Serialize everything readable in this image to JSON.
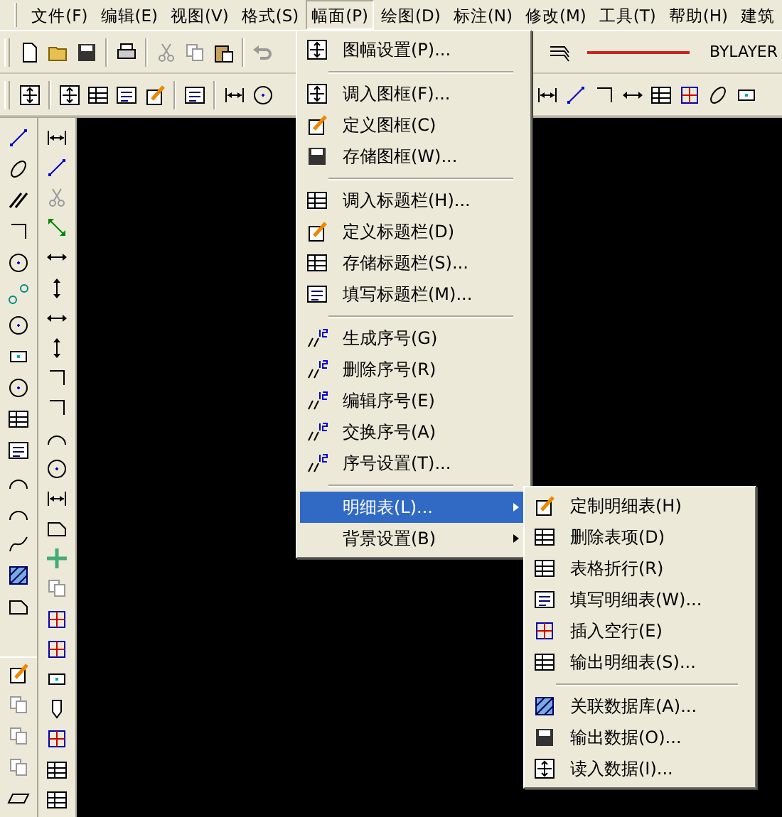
{
  "menubar": [
    {
      "label": "文件(F)",
      "selected": false
    },
    {
      "label": "编辑(E)",
      "selected": false
    },
    {
      "label": "视图(V)",
      "selected": false
    },
    {
      "label": "格式(S)",
      "selected": false
    },
    {
      "label": "幅面(P)",
      "selected": true
    },
    {
      "label": "绘图(D)",
      "selected": false
    },
    {
      "label": "标注(N)",
      "selected": false
    },
    {
      "label": "修改(M)",
      "selected": false
    },
    {
      "label": "工具(T)",
      "selected": false
    },
    {
      "label": "帮助(H)",
      "selected": false
    },
    {
      "label": "建筑",
      "selected": false
    }
  ],
  "toolbar": {
    "line_type": "BYLAYER"
  },
  "menu": {
    "items": [
      {
        "kind": "item",
        "label": "图幅设置(P)...",
        "selected": false
      },
      {
        "kind": "separator"
      },
      {
        "kind": "item",
        "label": "调入图框(F)...",
        "selected": false
      },
      {
        "kind": "item",
        "label": "定义图框(C)",
        "selected": false
      },
      {
        "kind": "item",
        "label": "存储图框(W)...",
        "selected": false
      },
      {
        "kind": "separator"
      },
      {
        "kind": "item",
        "label": "调入标题栏(H)...",
        "selected": false
      },
      {
        "kind": "item",
        "label": "定义标题栏(D)",
        "selected": false
      },
      {
        "kind": "item",
        "label": "存储标题栏(S)...",
        "selected": false
      },
      {
        "kind": "item",
        "label": "填写标题栏(M)...",
        "selected": false
      },
      {
        "kind": "separator"
      },
      {
        "kind": "item",
        "label": "生成序号(G)",
        "selected": false
      },
      {
        "kind": "item",
        "label": "删除序号(R)",
        "selected": false
      },
      {
        "kind": "item",
        "label": "编辑序号(E)",
        "selected": false
      },
      {
        "kind": "item",
        "label": "交换序号(A)",
        "selected": false
      },
      {
        "kind": "item",
        "label": "序号设置(T)...",
        "selected": false
      },
      {
        "kind": "separator"
      },
      {
        "kind": "submenu",
        "label": "明细表(L)...",
        "selected": true
      },
      {
        "kind": "submenu",
        "label": "背景设置(B)",
        "selected": false
      }
    ]
  },
  "submenu": {
    "items": [
      {
        "kind": "item",
        "label": "定制明细表(H)",
        "selected": false
      },
      {
        "kind": "item",
        "label": "删除表项(D)",
        "selected": false
      },
      {
        "kind": "item",
        "label": "表格折行(R)",
        "selected": false
      },
      {
        "kind": "item",
        "label": "填写明细表(W)...",
        "selected": false
      },
      {
        "kind": "item",
        "label": "插入空行(E)",
        "selected": false
      },
      {
        "kind": "item",
        "label": "输出明细表(S)...",
        "selected": false
      },
      {
        "kind": "separator"
      },
      {
        "kind": "item",
        "label": "关联数据库(A)...",
        "selected": false
      },
      {
        "kind": "item",
        "label": "输出数据(O)...",
        "selected": false
      },
      {
        "kind": "item",
        "label": "读入数据(I)...",
        "selected": false
      }
    ]
  }
}
